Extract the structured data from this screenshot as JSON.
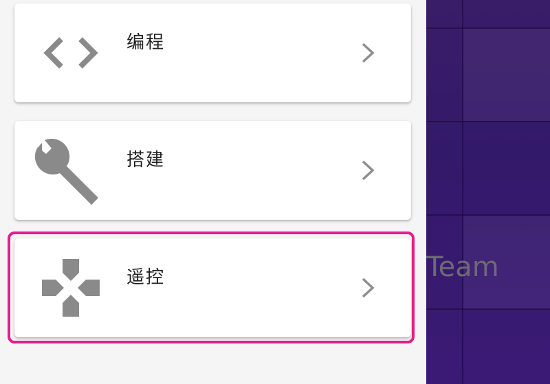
{
  "menu": {
    "items": [
      {
        "label": "编程",
        "icon": "code-brackets-icon"
      },
      {
        "label": "搭建",
        "icon": "wrench-icon"
      },
      {
        "label": "遥控",
        "icon": "gamepad-dpad-icon"
      }
    ],
    "chevron_icon": "chevron-right-icon",
    "highlight_color": "#e61e8a"
  },
  "background": {
    "text": "Team",
    "color": "#33196a"
  }
}
